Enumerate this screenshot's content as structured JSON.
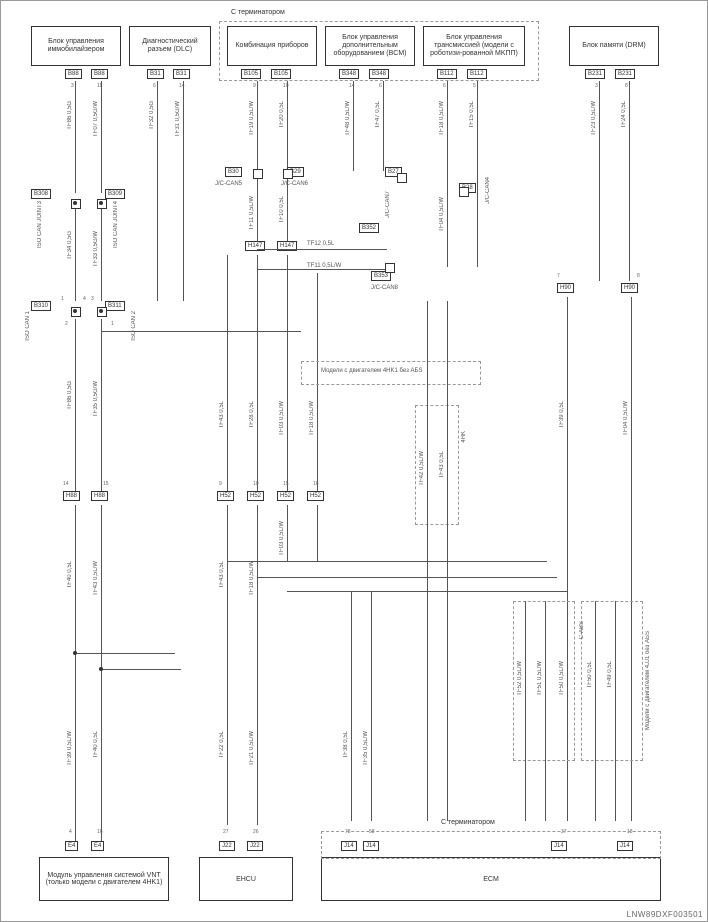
{
  "title_notes": {
    "top_left": "С терминатором",
    "top_right": "С терминатором",
    "bottom_note": "С терминатором"
  },
  "watermark": "LNW89DXF003501",
  "top_modules": [
    {
      "label": "Блок управления иммобилайзером",
      "conns": [
        "B88",
        "B88"
      ]
    },
    {
      "label": "Диагностический разъем (DLC)",
      "conns": [
        "B31",
        "B31"
      ]
    },
    {
      "label": "Комбинация приборов",
      "conns": [
        "B105",
        "B105"
      ]
    },
    {
      "label": "Блок управления дополнительным оборудованием (BCM)",
      "conns": [
        "B348",
        "B348"
      ]
    },
    {
      "label": "Блок управления трансмиссией (модели с роботизи-рованной MKПП)",
      "conns": [
        "B112",
        "B112"
      ]
    },
    {
      "label": "Блок памяти (DRM)",
      "conns": [
        "B231",
        "B231"
      ]
    }
  ],
  "side_labels": {
    "iso_can_joint3": "ISO CAN JOINT3",
    "iso_can_joint4": "ISO CAN JOINT4",
    "iso_can1": "ISO CAN 1",
    "iso_can2": "ISO CAN 2",
    "jc_can5": "J/C-CAN5",
    "jc_can6": "J/C-CAN6",
    "jc_can7": "J/C-CAN7",
    "jc_can8": "J/C-CAN8",
    "jc_can4": "J/C-CAN4",
    "c_abs": "C-ABS"
  },
  "mid_connectors": [
    "B308",
    "B309",
    "B310",
    "B311",
    "B30",
    "B29",
    "B27",
    "B352",
    "B353",
    "B28",
    "H147",
    "H147",
    "H52",
    "H52",
    "H52",
    "H52",
    "H90",
    "H90",
    "H88",
    "H88"
  ],
  "wire_signals": [
    "TF86 0,5G",
    "TF07 0,5G/W",
    "TF32 0,5G",
    "TF31 0,5G/W",
    "TF34 0,5G",
    "TF33 0,5G/W",
    "TF86 0,5G",
    "TF35 0,5G/W",
    "TF19 0,5L/W",
    "TF20 0,5L",
    "TF11 0,5L/W",
    "TF10 0,5L",
    "TF12 0,5L",
    "TF11 0,5L/W",
    "TF48 0,5L/W",
    "TF47 0,5L",
    "TF18 0,5L/W",
    "TF15 0,5L",
    "TF04 0,5L/W",
    "TF23 0,5L/W",
    "TF24 0,5L",
    "TF39 0,5L/W",
    "TF43 0,5L",
    "TF28 0,5L",
    "TF03 0,5L/W",
    "TF18 0,5L/W",
    "TF43 0,5L/W",
    "TF40 0,5L",
    "TF22 0,5L",
    "TF21 0,5L/W",
    "TF38 0,5L",
    "TF35 0,5L/W",
    "TF39 0,5L",
    "TF04 0,5L/W",
    "TF42 0,5L/W",
    "TF43 0,5L",
    "TF52 0,5L/W",
    "TF51 0,5L/W",
    "TF50 0,5L",
    "TF49 0,5L",
    "TF50 0,5L/W"
  ],
  "notes": {
    "model_4hk1_no_abs": "Модели с двигателем 4HK1 без АБS",
    "model_4hk1": "4HK",
    "model_4jj1_no_abs": "Модели с двигателем 4JJ1 без АБS"
  },
  "bottom_modules": [
    {
      "label": "Модуль управления системой VNT (только модели с двигателем 4HK1)",
      "conns": [
        "E4",
        "E4"
      ]
    },
    {
      "label": "EHCU",
      "conns": [
        "J22",
        "J22"
      ]
    },
    {
      "label": "ECM",
      "conns": [
        "J14",
        "J14",
        "J14",
        "J14"
      ]
    }
  ],
  "pins": [
    "1",
    "2",
    "3",
    "4",
    "5",
    "6",
    "7",
    "8",
    "9",
    "10",
    "11",
    "12",
    "13",
    "14",
    "15",
    "16",
    "17",
    "18",
    "26",
    "27",
    "37",
    "58",
    "77",
    "78"
  ]
}
